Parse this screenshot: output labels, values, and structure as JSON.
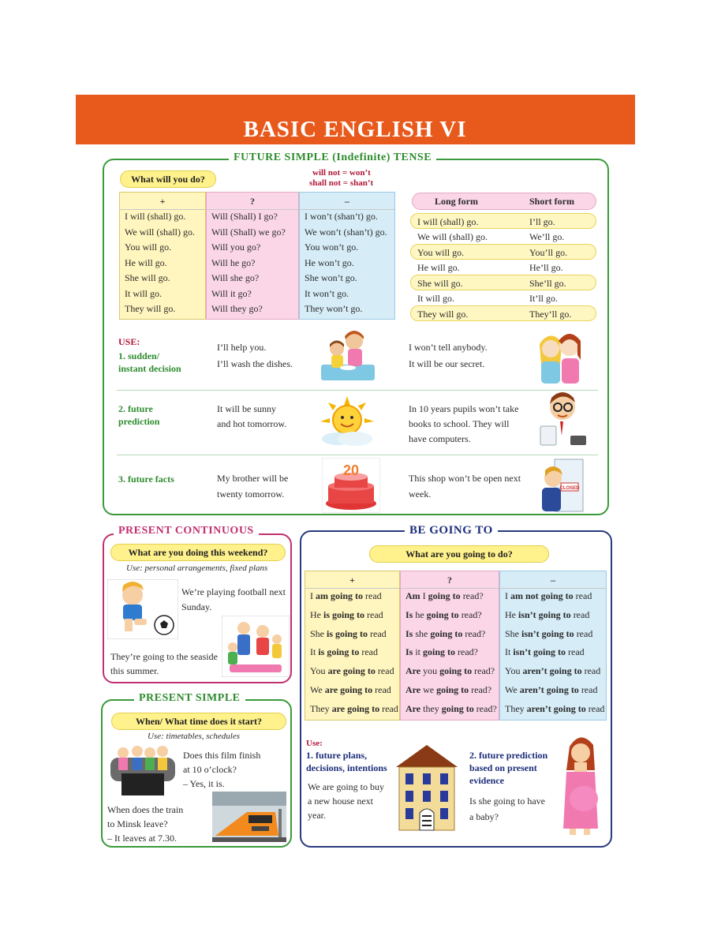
{
  "page_title": "BASIC ENGLISH VI",
  "future": {
    "title": "FUTURE SIMPLE (Indefinite) TENSE",
    "question": "What will you do?",
    "contraction_1": "will not = won’t",
    "contraction_2": "shall not = shan’t",
    "headers": [
      "+",
      "?",
      "–"
    ],
    "affirmative": [
      "I will (shall) go.",
      "We will (shall) go.",
      "You will go.",
      "He will go.",
      "She will go.",
      "It will go.",
      "They will go."
    ],
    "question_forms": [
      "Will (Shall) I go?",
      "Will  (Shall) we go?",
      "Will you go?",
      "Will he go?",
      "Will she go?",
      "Will it go?",
      "Will they go?"
    ],
    "negative": [
      "I won’t (shan’t) go.",
      "We won’t (shan’t) go.",
      "You won’t go.",
      "He won’t go.",
      "She won’t go.",
      "It won’t go.",
      "They won’t go."
    ],
    "long_header": "Long form",
    "short_header": "Short form",
    "long_forms": [
      "I will (shall) go.",
      "We will (shall) go.",
      "You will go.",
      "He will go.",
      "She will go.",
      "It will go.",
      "They will go."
    ],
    "short_forms": [
      "I’ll go.",
      "We’ll go.",
      "You’ll go.",
      "He’ll go.",
      "She’ll go.",
      "It’ll go.",
      "They’ll go."
    ],
    "use_label": "USE:",
    "use_1_a": "1. sudden/",
    "use_1_b": "instant decision",
    "use_1_ex1_a": "I’ll help you.",
    "use_1_ex1_b": "I’ll wash the dishes.",
    "use_1_ex2_a": "I won’t tell anybody.",
    "use_1_ex2_b": "It will be our secret.",
    "use_2_a": "2. future",
    "use_2_b": "prediction",
    "use_2_ex1_a": "It will be sunny",
    "use_2_ex1_b": "and hot tomorrow.",
    "use_2_ex2_a": "In 10 years pupils won’t take",
    "use_2_ex2_b": "books to school. They will",
    "use_2_ex2_c": "have computers.",
    "use_3": "3. future facts",
    "use_3_ex1_a": "My brother will be",
    "use_3_ex1_b": "twenty tomorrow.",
    "use_3_ex2_a": "This shop won’t be open next",
    "use_3_ex2_b": "week.",
    "cake_number": "20",
    "sign_text": "CLOSED"
  },
  "present_continuous": {
    "title": "PRESENT CONTINUOUS",
    "question": "What are you doing this weekend?",
    "use": "Use: personal arrangements, fixed plans",
    "ex1_a": "We’re playing football next",
    "ex1_b": "Sunday.",
    "ex2_a": "They’re going to the seaside",
    "ex2_b": "this summer."
  },
  "present_simple": {
    "title": "PRESENT SIMPLE",
    "question": "When/ What time does it start?",
    "use": "Use: timetables, schedules",
    "ex1_a": "Does this film finish",
    "ex1_b": "at 10 o’clock?",
    "ex1_c": "– Yes, it is.",
    "ex2_a": "When does the train",
    "ex2_b": "to Minsk leave?",
    "ex2_c": "– It leaves at 7.30."
  },
  "going_to": {
    "title": "BE GOING TO",
    "question": "What are you going to do?",
    "headers": [
      "+",
      "?",
      "–"
    ],
    "affirmative": [
      {
        "pre": "I",
        "bold": " am going to",
        "post": " read"
      },
      {
        "pre": "He",
        "bold": " is going to",
        "post": " read"
      },
      {
        "pre": "She",
        "bold": " is going to",
        "post": " read"
      },
      {
        "pre": "It",
        "bold": " is going to",
        "post": " read"
      },
      {
        "pre": "You",
        "bold": " are going to",
        "post": " read"
      },
      {
        "pre": "We",
        "bold": " are going to",
        "post": " read"
      },
      {
        "pre": "They",
        "bold": " are going to",
        "post": " read"
      }
    ],
    "question_forms": [
      {
        "b1": "Am",
        "mid": " I ",
        "b2": " going to",
        "post": " read?"
      },
      {
        "b1": "Is",
        "mid": " he ",
        "b2": "going to",
        "post": " read?"
      },
      {
        "b1": "Is",
        "mid": " she ",
        "b2": "going to",
        "post": " read?"
      },
      {
        "b1": "Is",
        "mid": " it ",
        "b2": "going to",
        "post": " read?"
      },
      {
        "b1": "Are",
        "mid": " you ",
        "b2": "going to",
        "post": " read?"
      },
      {
        "b1": "Are",
        "mid": " we ",
        "b2": "going to",
        "post": " read?"
      },
      {
        "b1": "Are",
        "mid": " they ",
        "b2": "going to",
        "post": " read?"
      }
    ],
    "negative": [
      {
        "pre": "I",
        "bold": " am not going to",
        "post": " read"
      },
      {
        "pre": "He",
        "bold": " isn’t going to",
        "post": " read"
      },
      {
        "pre": "She",
        "bold": " isn’t going to",
        "post": " read"
      },
      {
        "pre": "It",
        "bold": " isn’t going to",
        "post": " read"
      },
      {
        "pre": "You",
        "bold": " aren’t going to",
        "post": " read"
      },
      {
        "pre": "We",
        "bold": " aren’t going to",
        "post": " read"
      },
      {
        "pre": "They",
        "bold": " aren’t going to",
        "post": " read"
      }
    ],
    "use_label": "Use:",
    "use_1_a": "1. future plans,",
    "use_1_b": "decisions, intentions",
    "use_1_ex_a": "We are going to buy",
    "use_1_ex_b": "a new house next",
    "use_1_ex_c": "year.",
    "use_2_a": "2. future prediction",
    "use_2_b": "based on present",
    "use_2_c": "evidence",
    "use_2_ex_a": "Is she going to have",
    "use_2_ex_b": "a baby?"
  },
  "colors": {
    "banner": "#e8591c",
    "future_border": "#3a9a3a",
    "continuous_border": "#c0306e",
    "going_to_border": "#2a3a7e",
    "highlight": "#fff18c"
  }
}
